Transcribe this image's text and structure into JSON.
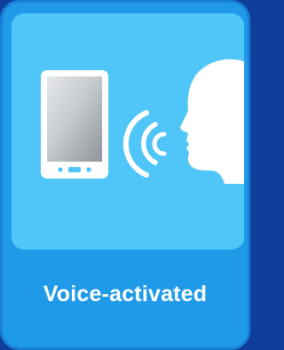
{
  "card": {
    "caption": "Voice-activated",
    "icons": [
      "phone-icon",
      "sound-waves-icon",
      "human-head-icon"
    ]
  },
  "colors": {
    "outer_background": "#0f3f9a",
    "card_background": "#1e9ae8",
    "illustration_background": "#4fc6f7",
    "icon_white": "#ffffff",
    "screen_gray": "#bfc3c8"
  }
}
